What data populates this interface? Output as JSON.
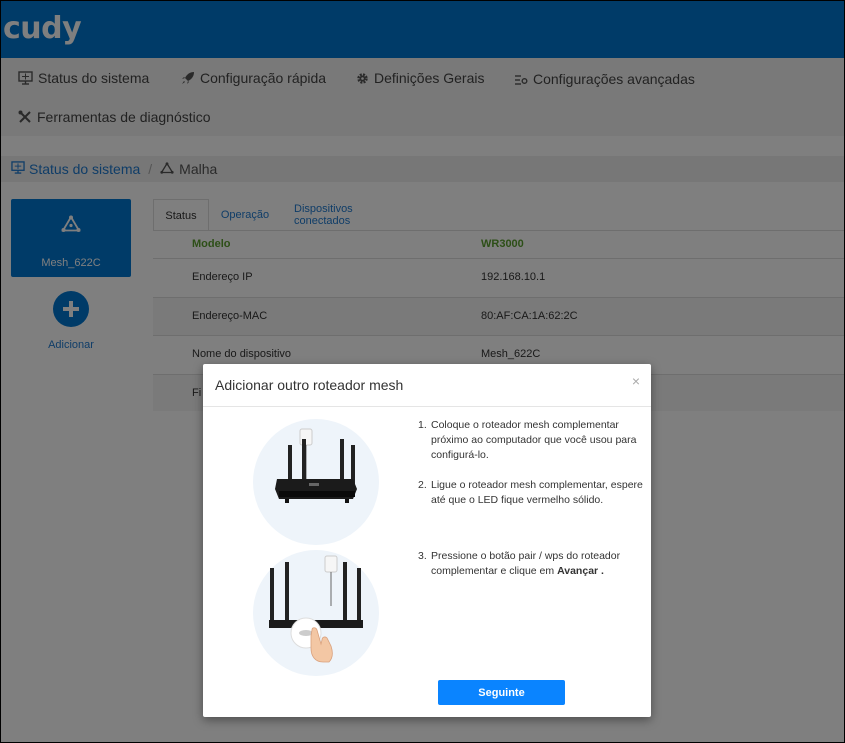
{
  "brand": {
    "logo": "cudy",
    "header_color": "#0076d0"
  },
  "nav": {
    "items": [
      {
        "label": "Status do sistema",
        "icon": "monitor-icon"
      },
      {
        "label": "Configuração rápida",
        "icon": "rocket-icon"
      },
      {
        "label": "Definições Gerais",
        "icon": "gear-icon"
      },
      {
        "label": "Configurações avançadas",
        "icon": "advanced-settings-icon"
      },
      {
        "label": "Ferramentas de diagnóstico",
        "icon": "tools-icon"
      }
    ]
  },
  "breadcrumb": {
    "parent": "Status do sistema",
    "separator": "/",
    "current": "Malha"
  },
  "sidebar": {
    "device_label": "Mesh_622C",
    "add_label": "Adicionar"
  },
  "tabs": [
    {
      "label": "Status",
      "active": true
    },
    {
      "label": "Operação",
      "active": false
    },
    {
      "label": "Dispositivos conectados",
      "active": false
    }
  ],
  "table": {
    "header": {
      "key": "Modelo",
      "value": "WR3000"
    },
    "rows": [
      {
        "key": "Endereço IP",
        "value": "192.168.10.1"
      },
      {
        "key": "Endereço-MAC",
        "value": "80:AF:CA:1A:62:2C"
      },
      {
        "key": "Nome do dispositivo",
        "value": "Mesh_622C"
      },
      {
        "key": "Fi"
      }
    ]
  },
  "modal": {
    "title": "Adicionar outro roteador mesh",
    "close": "×",
    "steps": [
      {
        "num": "1.",
        "text": "Coloque o roteador mesh complementar próximo ao computador que você usou para configurá-lo."
      },
      {
        "num": "2.",
        "text": "Ligue o roteador mesh complementar, espere até que o LED fique vermelho sólido."
      },
      {
        "num": "3.",
        "text_before": "Pressione o botão pair / wps do roteador complementar e clique em ",
        "text_bold": "Avançar ."
      }
    ],
    "next_button": "Seguinte",
    "button_color": "#0a84ff"
  }
}
